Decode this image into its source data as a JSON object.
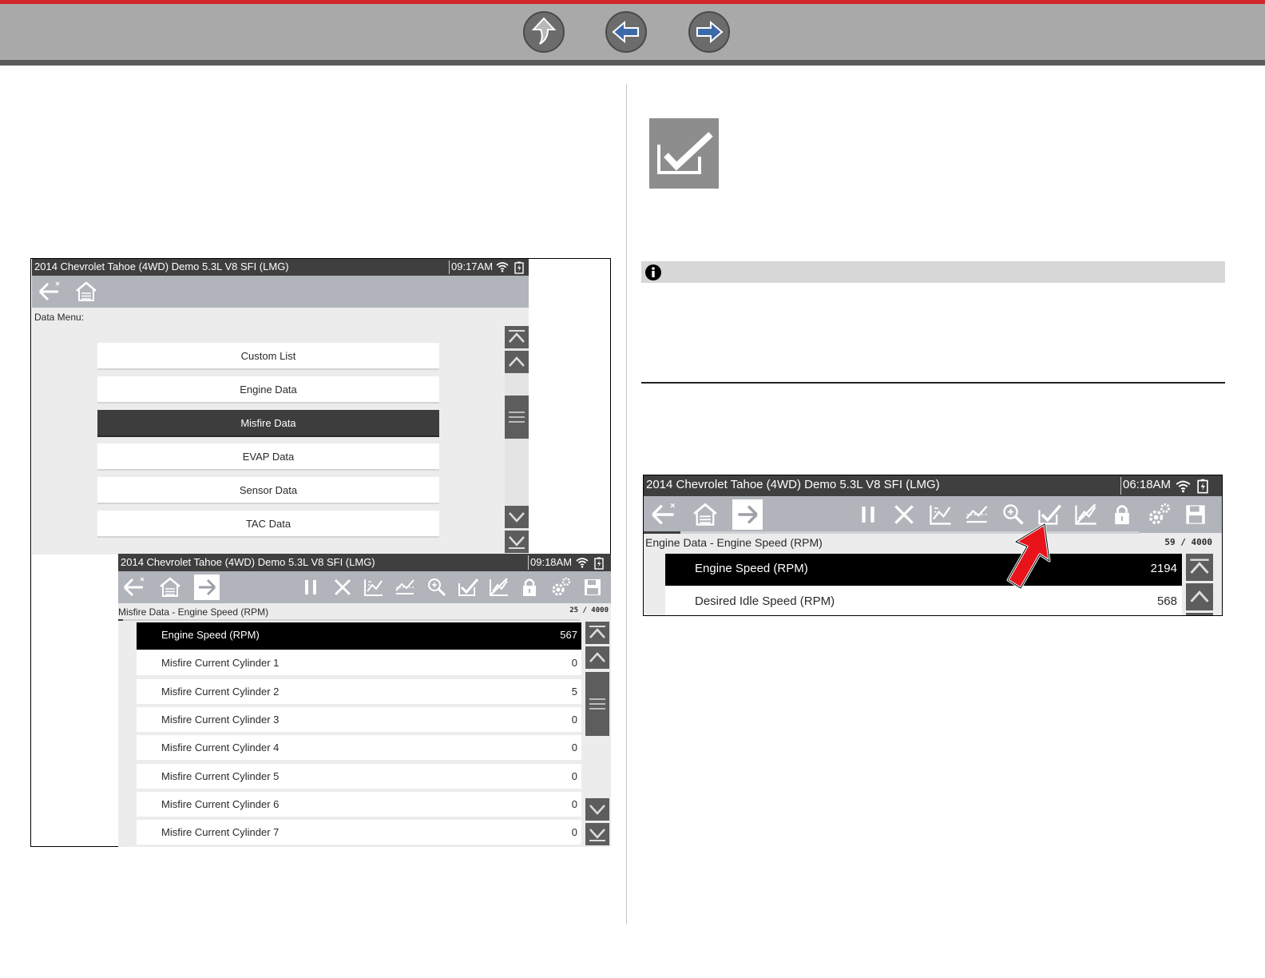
{
  "nav": {
    "up_icon": "up-arrow-icon",
    "back_icon": "left-arrow-icon",
    "forward_icon": "right-arrow-icon"
  },
  "colors": {
    "brand_red": "#d1262b",
    "nav_gray": "#a9a9a9",
    "toolbar_blue_gray": "#b1b4ba",
    "title_bar": "#3f3f3f",
    "selected_row": "#000000",
    "pointer_red": "#e8131b"
  },
  "screen1": {
    "title": "2014 Chevrolet Tahoe (4WD) Demo 5.3L V8 SFI (LMG)",
    "time": "09:17AM",
    "menu_label": "Data Menu:",
    "items": [
      "Custom List",
      "Engine Data",
      "Misfire Data",
      "EVAP Data",
      "Sensor Data",
      "TAC Data"
    ],
    "selected": "Misfire Data"
  },
  "screen2": {
    "title": "2014 Chevrolet Tahoe (4WD) Demo 5.3L V8 SFI (LMG)",
    "time": "09:18AM",
    "subtitle": "Misfire Data - Engine Speed (RPM)",
    "counter": "25 / 4000",
    "rows": [
      {
        "name": "Engine Speed (RPM)",
        "value": "567"
      },
      {
        "name": "Misfire Current Cylinder 1",
        "value": "0"
      },
      {
        "name": "Misfire Current Cylinder 2",
        "value": "5"
      },
      {
        "name": "Misfire Current Cylinder 3",
        "value": "0"
      },
      {
        "name": "Misfire Current Cylinder 4",
        "value": "0"
      },
      {
        "name": "Misfire Current Cylinder 5",
        "value": "0"
      },
      {
        "name": "Misfire Current Cylinder 6",
        "value": "0"
      },
      {
        "name": "Misfire Current Cylinder 7",
        "value": "0"
      }
    ]
  },
  "screen3": {
    "title": "2014 Chevrolet Tahoe (4WD) Demo 5.3L V8 SFI (LMG)",
    "time": "06:18AM",
    "subtitle": "Engine Data - Engine Speed (RPM)",
    "counter": "59 / 4000",
    "rows": [
      {
        "name": "Engine Speed (RPM)",
        "value": "2194"
      },
      {
        "name": "Desired Idle Speed (RPM)",
        "value": "568"
      }
    ]
  },
  "toolbar_icons": [
    "back-icon",
    "home-icon",
    "next-icon",
    "pause-icon",
    "clear-icon",
    "graph-icon",
    "graph-fill-icon",
    "zoom-icon",
    "select-check-icon",
    "no-graph-icon",
    "lock-icon",
    "settings-icon",
    "save-icon"
  ],
  "info": {
    "icon": "info-icon"
  },
  "feature_icon": "checkmark-select-icon"
}
